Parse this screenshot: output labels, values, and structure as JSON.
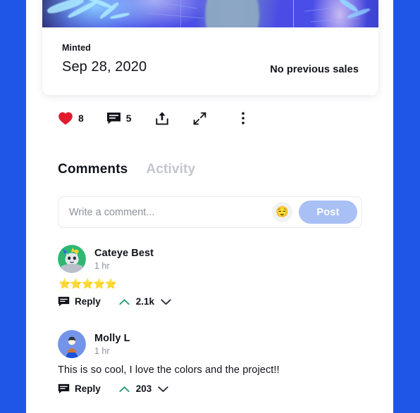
{
  "theme": {
    "page_background": "#1f56e8",
    "sheet_background": "#ffffff",
    "accent_post": "#a9c0f5",
    "upvote_green": "#2a9d6e",
    "heart_red": "#e01b2e",
    "text_primary": "#11131a",
    "text_muted": "#8c9098",
    "tab_inactive": "#c3c6cc"
  },
  "artwork_card": {
    "minted_label": "Minted",
    "minted_date": "Sep 28, 2020",
    "sales_text": "No previous sales"
  },
  "action_bar": {
    "like": {
      "icon": "heart-icon",
      "count": "8"
    },
    "comment": {
      "icon": "comment-bubble-icon",
      "count": "5"
    },
    "share": {
      "icon": "share-icon"
    },
    "expand": {
      "icon": "expand-icon"
    },
    "more": {
      "icon": "more-vertical-icon"
    }
  },
  "tabs": [
    {
      "label": "Comments",
      "active": true
    },
    {
      "label": "Activity",
      "active": false
    }
  ],
  "composer": {
    "placeholder": "Write a comment...",
    "value": "",
    "emoji_icon": "emoji-smiley-icon",
    "emoji_glyph": "😌",
    "post_label": "Post",
    "post_enabled": false
  },
  "comments": [
    {
      "author": "Cateye Best",
      "time": "1 hr",
      "avatar": "cat-avatar",
      "body": "",
      "rating": "⭐⭐⭐⭐⭐",
      "reply_label": "Reply",
      "score": "2.1k",
      "upvote_icon": "chevron-up-icon",
      "downvote_icon": "chevron-down-icon",
      "reply_icon": "comment-bubble-icon"
    },
    {
      "author": "Molly L",
      "time": "1 hr",
      "avatar": "person-avatar",
      "body": "This is so cool, I love the colors and the project!!",
      "rating": "",
      "reply_label": "Reply",
      "score": "203",
      "upvote_icon": "chevron-up-icon",
      "downvote_icon": "chevron-down-icon",
      "reply_icon": "comment-bubble-icon"
    }
  ]
}
